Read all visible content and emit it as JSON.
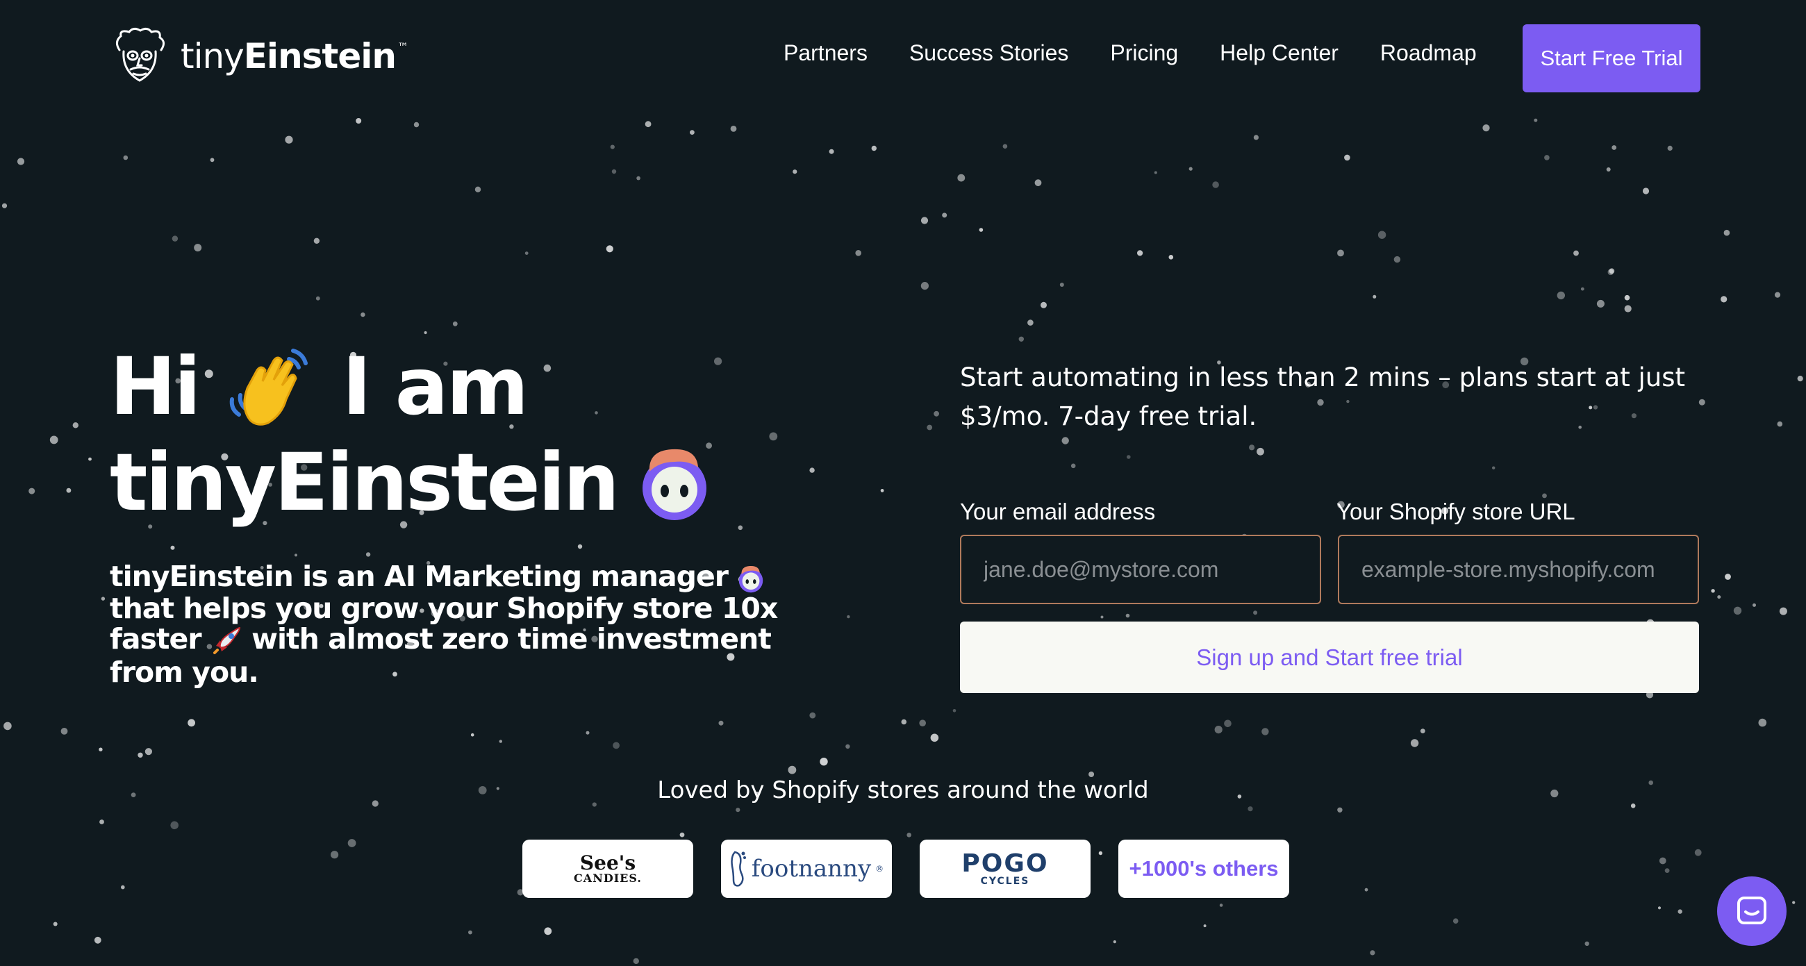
{
  "brand": {
    "name_light": "tiny",
    "name_bold": "Einstein",
    "trademark": "™",
    "logo_icon": "einstein-face-icon"
  },
  "nav": {
    "items": [
      {
        "label": "Partners"
      },
      {
        "label": "Success Stories"
      },
      {
        "label": "Pricing"
      },
      {
        "label": "Help Center"
      },
      {
        "label": "Roadmap"
      }
    ],
    "cta_label": "Start Free Trial"
  },
  "hero": {
    "line1_start": "Hi",
    "line1_end": "I am",
    "line2": "tinyEinstein",
    "wave_icon": "waving-hand-icon",
    "mascot_icon": "robot-mascot-icon",
    "desc_part1": "tinyEinstein is an AI Marketing manager",
    "desc_part2": "that helps you grow your Shopify store 10x faster",
    "desc_part3": "with almost zero time investment from you.",
    "rocket_icon": "rocket-icon"
  },
  "signup": {
    "pitch": "Start automating in less than 2 mins – plans start at just $3/mo. 7-day free trial.",
    "email_label": "Your email address",
    "email_placeholder": "jane.doe@mystore.com",
    "email_value": "",
    "url_label": "Your Shopify store URL",
    "url_placeholder": "example-store.myshopify.com",
    "url_value": "",
    "submit_label": "Sign up and Start free trial"
  },
  "social_proof": {
    "heading": "Loved by Shopify stores around the world",
    "sees": {
      "line1": "See's",
      "line2": "CANDIES."
    },
    "footnanny": {
      "text": "footnanny",
      "mark": "®"
    },
    "pogo": {
      "line1": "POGO",
      "line2": "CYCLES"
    },
    "others": "+1000's others"
  },
  "chat": {
    "icon": "chat-icon"
  },
  "colors": {
    "background": "#101a1f",
    "accent": "#7c5cf2",
    "input_border": "#b07a5c",
    "button_bg": "#f8f9f4"
  }
}
